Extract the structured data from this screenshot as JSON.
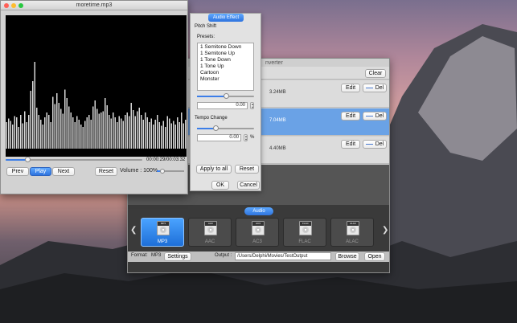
{
  "player": {
    "title": "moretime.mp3",
    "time": "00:00:29/00:03:32",
    "progress": 0.16,
    "volume_label": "Volume : 100%",
    "volume": 0.2,
    "buttons": {
      "prev": "Prev",
      "play": "Play",
      "next": "Next",
      "reset": "Reset"
    },
    "spectrum_bars": [
      0.22,
      0.25,
      0.23,
      0.2,
      0.27,
      0.26,
      0.18,
      0.28,
      0.21,
      0.31,
      0.22,
      0.28,
      0.48,
      0.56,
      0.72,
      0.34,
      0.28,
      0.24,
      0.2,
      0.26,
      0.3,
      0.28,
      0.22,
      0.43,
      0.37,
      0.46,
      0.38,
      0.33,
      0.29,
      0.49,
      0.42,
      0.35,
      0.3,
      0.26,
      0.22,
      0.27,
      0.24,
      0.2,
      0.18,
      0.23,
      0.26,
      0.28,
      0.24,
      0.35,
      0.4,
      0.33,
      0.29,
      0.3,
      0.31,
      0.42,
      0.36,
      0.28,
      0.25,
      0.3,
      0.26,
      0.22,
      0.27,
      0.25,
      0.23,
      0.28,
      0.3,
      0.27,
      0.38,
      0.32,
      0.27,
      0.31,
      0.34,
      0.28,
      0.24,
      0.3,
      0.26,
      0.22,
      0.25,
      0.2,
      0.24,
      0.28,
      0.22,
      0.19,
      0.23,
      0.18,
      0.27,
      0.25,
      0.21,
      0.23,
      0.2,
      0.26,
      0.22,
      0.3,
      0.21,
      0.24
    ]
  },
  "effect": {
    "tab": "Audio Effect",
    "pitch_label": "Pitch Shift",
    "presets_label": "Presets:",
    "presets": [
      "1 Semitone Down",
      "1 Semitone Up",
      "1 Tone Down",
      "1 Tone Up",
      "Cartoon",
      "Monster"
    ],
    "pitch_value": "0.00",
    "pitch_slider": 0.5,
    "tempo_label": "Tempo Change",
    "tempo_value": "0.00",
    "tempo_unit": "%",
    "tempo_slider": 0.33,
    "apply_all": "Apply to all",
    "reset": "Reset",
    "ok": "OK",
    "cancel": "Cancel"
  },
  "converter": {
    "title_fragment": "nverter",
    "clear": "Clear",
    "rows": [
      {
        "size": "3.24MB",
        "edit": "Edit",
        "del": "Del",
        "selected": false
      },
      {
        "size": "7.04MB",
        "edit": "Edit",
        "del": "Del",
        "selected": true
      },
      {
        "size": "4.40MB",
        "edit": "Edit",
        "del": "Del",
        "selected": false
      }
    ],
    "format_tab": "Audio",
    "formats": [
      {
        "tag": "MP3",
        "label": "MP3",
        "active": true
      },
      {
        "tag": "AAC",
        "label": "AAC",
        "active": false
      },
      {
        "tag": "AC3",
        "label": "AC3",
        "active": false
      },
      {
        "tag": "FLAC",
        "label": "FLAC",
        "active": false
      },
      {
        "tag": "ALAC",
        "label": "ALAC",
        "active": false
      }
    ],
    "format_label": "Format:",
    "format_value": "MP3",
    "settings": "Settings",
    "output_label": "Output :",
    "output_path": "/Users/Delphi/Movies/TestOutput",
    "browse": "Browse",
    "open": "Open"
  },
  "colors": {
    "accent": "#2e73de",
    "selection": "#6aa2e6",
    "bars": "#d8d8d8"
  }
}
